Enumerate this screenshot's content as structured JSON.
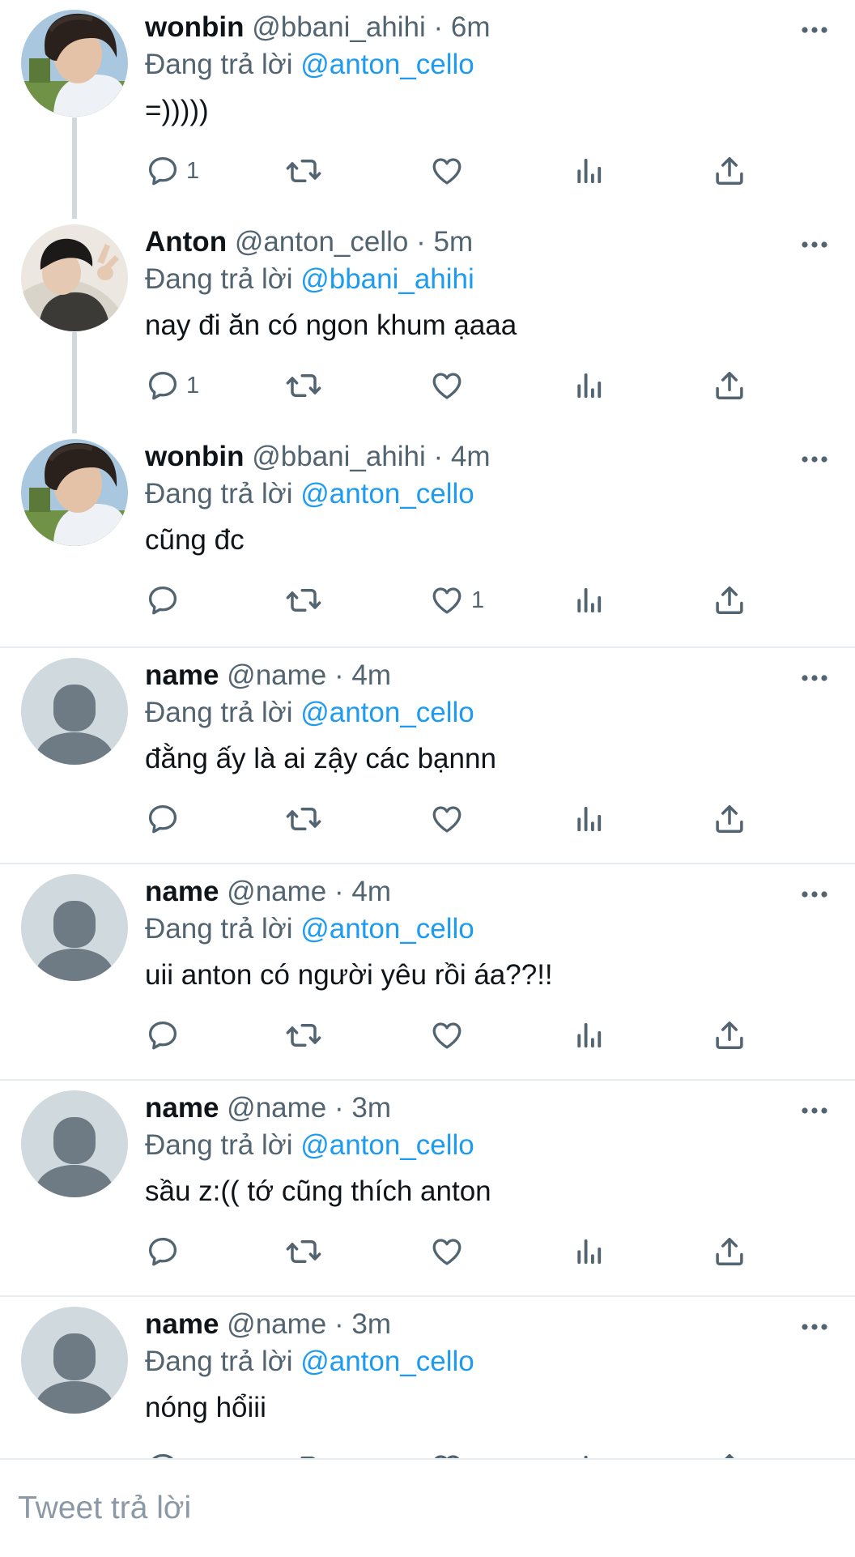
{
  "reply_prefix": "Đang trả lời",
  "tweets": [
    {
      "display_name": "wonbin",
      "handle": "@bbani_ahihi",
      "time": "· 6m",
      "reply_to": "@anton_cello",
      "text": "=)))))",
      "reply_count": "1",
      "like_count": "",
      "avatar": "photo-wonbin"
    },
    {
      "display_name": "Anton",
      "handle": "@anton_cello",
      "time": "· 5m",
      "reply_to": "@bbani_ahihi",
      "text": "nay đi ăn có ngon khum ạaaa",
      "reply_count": "1",
      "like_count": "",
      "avatar": "photo-anton"
    },
    {
      "display_name": "wonbin",
      "handle": "@bbani_ahihi",
      "time": "· 4m",
      "reply_to": "@anton_cello",
      "text": "cũng đc",
      "reply_count": "",
      "like_count": "1",
      "avatar": "photo-wonbin"
    },
    {
      "display_name": "name",
      "handle": "@name",
      "time": "· 4m",
      "reply_to": "@anton_cello",
      "text": "đằng ấy là ai zậy các bạnnn",
      "reply_count": "",
      "like_count": "",
      "avatar": "default"
    },
    {
      "display_name": "name",
      "handle": "@name",
      "time": "· 4m",
      "reply_to": "@anton_cello",
      "text": "uii anton có người yêu rồi áa??!!",
      "reply_count": "",
      "like_count": "",
      "avatar": "default"
    },
    {
      "display_name": "name",
      "handle": "@name",
      "time": "· 3m",
      "reply_to": "@anton_cello",
      "text": "sầu z:(( tớ cũng thích anton",
      "reply_count": "",
      "like_count": "",
      "avatar": "default"
    },
    {
      "display_name": "name",
      "handle": "@name",
      "time": "· 3m",
      "reply_to": "@anton_cello",
      "text": "nóng hổiii",
      "reply_count": "",
      "like_count": "",
      "avatar": "default"
    }
  ],
  "reply_bar": {
    "placeholder": "Tweet trả lời"
  },
  "colors": {
    "link": "#1d9bf0",
    "secondary": "#536471",
    "separator": "#e6ecf0",
    "thread_line": "#cfd9de"
  }
}
